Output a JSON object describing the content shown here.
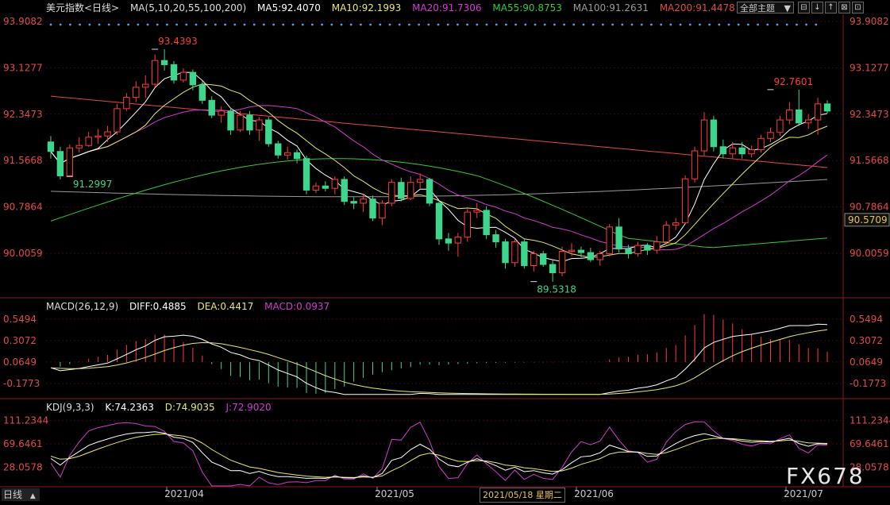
{
  "header": {
    "symbol_label": "美元指数<日线>",
    "ma_label": "MA(5,10,20,55,100,200)",
    "ma5": "MA5:92.4070",
    "ma10": "MA10:92.1993",
    "ma20": "MA20:91.7306",
    "ma55": "MA55:90.8753",
    "ma100": "MA100:91.2631",
    "ma200": "MA200:91.4478",
    "theme_label": "全部主题",
    "theme_arrow": "▼"
  },
  "toolbar": {
    "buttons": [
      "⊟",
      "↓",
      "↑",
      "⊠",
      "⊡"
    ]
  },
  "macd_header": {
    "label": "MACD(26,12,9)",
    "diff": "DIFF:0.4885",
    "dea": "DEA:0.4417",
    "macd": "MACD:0.0937"
  },
  "kdj_header": {
    "label": "KDJ(9,3,3)",
    "k": "K:74.2363",
    "d": "D:74.9035",
    "j": "J:72.9020"
  },
  "tab_label": "日线",
  "tab_arrow": "▲",
  "cursor_date": "2021/05/18 星期二",
  "watermark": "FX678",
  "colors": {
    "up": "#ff3b3b",
    "down": "#3dd68c",
    "ma5": "#ffffff",
    "ma10": "#e8e86a",
    "ma20": "#d23ad2",
    "ma55": "#36c936",
    "ma100": "#9a9a9a",
    "ma200": "#e24a4a",
    "price_axis": "#e24a4a",
    "date_axis": "#cccccc",
    "grid": "#3a0a0a"
  },
  "chart_data": [
    {
      "type": "candlestick",
      "y_ticks": [
        "93.9082",
        "93.1277",
        "92.3473",
        "91.5668",
        "90.7864",
        "90.0059"
      ],
      "ylim": [
        89.3,
        94.0
      ],
      "current_price_label": "90.5709",
      "x_ticks": [
        "2021/04",
        "2021/05",
        "2021/06",
        "2021/07"
      ],
      "annotations": [
        {
          "text": "93.4393",
          "x_index": 11,
          "value": 93.4393
        },
        {
          "text": "91.2997",
          "x_index": 2,
          "value": 91.2997
        },
        {
          "text": "89.5318",
          "x_index": 51,
          "value": 89.5318
        },
        {
          "text": "92.7601",
          "x_index": 76,
          "value": 92.7601
        }
      ],
      "candles": [
        [
          91.88,
          91.72,
          91.98,
          91.6
        ],
        [
          91.72,
          91.31,
          91.8,
          91.25
        ],
        [
          91.31,
          91.78,
          91.84,
          91.3
        ],
        [
          91.78,
          91.82,
          91.96,
          91.7
        ],
        [
          91.82,
          91.96,
          92.05,
          91.8
        ],
        [
          91.96,
          91.98,
          92.1,
          91.85
        ],
        [
          91.98,
          92.05,
          92.15,
          91.88
        ],
        [
          92.05,
          92.44,
          92.52,
          92.0
        ],
        [
          92.44,
          92.63,
          92.7,
          92.4
        ],
        [
          92.63,
          92.8,
          92.9,
          92.55
        ],
        [
          92.8,
          92.85,
          93.0,
          92.62
        ],
        [
          92.85,
          93.25,
          93.35,
          92.8
        ],
        [
          93.25,
          93.18,
          93.44,
          93.08
        ],
        [
          93.18,
          92.92,
          93.24,
          92.86
        ],
        [
          92.92,
          93.05,
          93.12,
          92.88
        ],
        [
          93.05,
          92.84,
          93.1,
          92.75
        ],
        [
          92.84,
          92.58,
          92.9,
          92.52
        ],
        [
          92.58,
          92.33,
          92.65,
          92.28
        ],
        [
          92.33,
          92.4,
          92.48,
          92.2
        ],
        [
          92.4,
          92.08,
          92.45,
          92.0
        ],
        [
          92.08,
          92.33,
          92.4,
          92.05
        ],
        [
          92.33,
          92.08,
          92.4,
          92.0
        ],
        [
          92.08,
          92.25,
          92.3,
          91.9
        ],
        [
          92.25,
          91.85,
          92.3,
          91.8
        ],
        [
          91.85,
          91.66,
          91.9,
          91.6
        ],
        [
          91.66,
          91.7,
          91.8,
          91.58
        ],
        [
          91.7,
          91.6,
          91.75,
          91.52
        ],
        [
          91.6,
          91.07,
          91.65,
          91.0
        ],
        [
          91.07,
          91.14,
          91.2,
          91.02
        ],
        [
          91.14,
          91.1,
          91.22,
          91.05
        ],
        [
          91.1,
          91.25,
          91.3,
          91.0
        ],
        [
          91.25,
          90.88,
          91.3,
          90.82
        ],
        [
          90.88,
          90.85,
          90.95,
          90.75
        ],
        [
          90.85,
          90.92,
          91.0,
          90.7
        ],
        [
          90.92,
          90.6,
          90.98,
          90.55
        ],
        [
          90.6,
          90.85,
          90.9,
          90.48
        ],
        [
          90.85,
          91.2,
          91.25,
          90.8
        ],
        [
          91.2,
          90.93,
          91.28,
          90.88
        ],
        [
          90.93,
          91.2,
          91.3,
          90.9
        ],
        [
          91.2,
          91.25,
          91.35,
          91.1
        ],
        [
          91.25,
          90.85,
          91.28,
          90.8
        ],
        [
          90.85,
          90.25,
          90.9,
          90.15
        ],
        [
          90.25,
          90.18,
          90.35,
          90.05
        ],
        [
          90.18,
          90.28,
          90.35,
          89.95
        ],
        [
          90.28,
          90.7,
          90.75,
          90.2
        ],
        [
          90.7,
          90.73,
          90.85,
          90.6
        ],
        [
          90.73,
          90.32,
          90.8,
          90.25
        ],
        [
          90.32,
          90.2,
          90.4,
          90.1
        ],
        [
          90.2,
          89.85,
          90.25,
          89.75
        ],
        [
          89.85,
          90.2,
          90.25,
          89.78
        ],
        [
          90.2,
          89.8,
          90.25,
          89.75
        ],
        [
          89.8,
          90.0,
          90.05,
          89.7
        ],
        [
          90.0,
          89.82,
          90.05,
          89.78
        ],
        [
          89.82,
          89.68,
          89.9,
          89.53
        ],
        [
          89.68,
          90.04,
          90.12,
          89.62
        ],
        [
          90.04,
          90.06,
          90.18,
          89.96
        ],
        [
          90.06,
          90.02,
          90.12,
          89.94
        ],
        [
          90.02,
          89.9,
          90.1,
          89.86
        ],
        [
          89.9,
          90.0,
          90.05,
          89.8
        ],
        [
          90.0,
          90.45,
          90.5,
          89.95
        ],
        [
          90.45,
          90.08,
          90.6,
          90.02
        ],
        [
          90.08,
          90.0,
          90.15,
          89.92
        ],
        [
          90.0,
          90.14,
          90.2,
          89.95
        ],
        [
          90.14,
          90.06,
          90.18,
          89.98
        ],
        [
          90.06,
          90.2,
          90.3,
          90.0
        ],
        [
          90.2,
          90.48,
          90.55,
          90.15
        ],
        [
          90.48,
          90.52,
          90.6,
          90.4
        ],
        [
          90.52,
          91.26,
          91.32,
          90.5
        ],
        [
          91.26,
          91.73,
          91.8,
          91.2
        ],
        [
          91.73,
          92.25,
          92.38,
          91.65
        ],
        [
          92.25,
          91.8,
          92.32,
          91.72
        ],
        [
          91.8,
          91.68,
          91.92,
          91.6
        ],
        [
          91.68,
          91.78,
          91.88,
          91.6
        ],
        [
          91.78,
          91.68,
          91.88,
          91.6
        ],
        [
          91.68,
          91.75,
          91.82,
          91.62
        ],
        [
          91.75,
          91.94,
          92.0,
          91.7
        ],
        [
          91.94,
          92.04,
          92.12,
          91.88
        ],
        [
          92.04,
          92.25,
          92.32,
          91.98
        ],
        [
          92.25,
          92.42,
          92.55,
          92.18
        ],
        [
          92.42,
          92.2,
          92.76,
          92.15
        ],
        [
          92.2,
          92.25,
          92.35,
          92.1
        ],
        [
          92.25,
          92.52,
          92.62,
          92.0
        ],
        [
          92.52,
          92.4,
          92.58,
          92.36
        ]
      ]
    },
    {
      "type": "macd",
      "y_ticks": [
        "0.5494",
        "0.3072",
        "0.0649",
        "-0.1773"
      ],
      "ylim": [
        -0.33,
        0.62
      ]
    },
    {
      "type": "kdj",
      "y_ticks": [
        "111.2344",
        "69.6461",
        "28.0578"
      ],
      "ylim": [
        -5,
        125
      ]
    }
  ]
}
